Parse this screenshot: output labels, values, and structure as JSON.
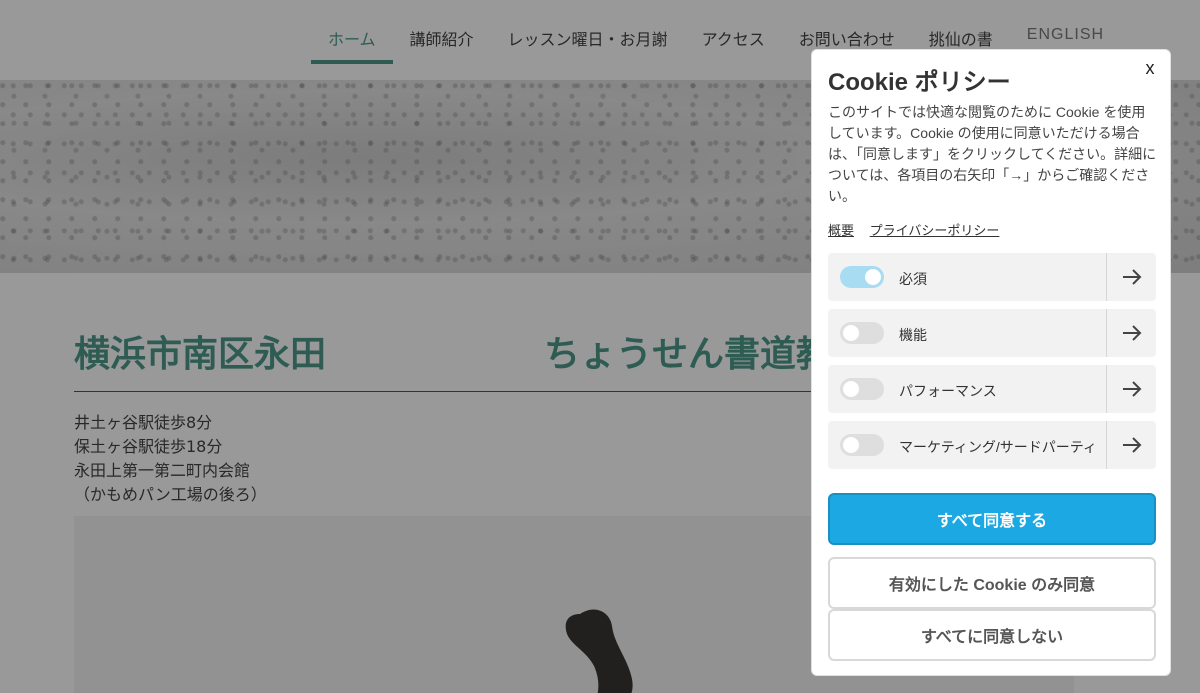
{
  "nav": {
    "items": [
      {
        "label": "ホーム",
        "active": true
      },
      {
        "label": "講師紹介",
        "active": false
      },
      {
        "label": "レッスン曜日・お月謝",
        "active": false
      },
      {
        "label": "アクセス",
        "active": false
      },
      {
        "label": "お問い合わせ",
        "active": false
      },
      {
        "label": "挑仙の書",
        "active": false
      },
      {
        "label": "ENGLISH",
        "active": false
      }
    ]
  },
  "main": {
    "title_left": "横浜市南区永田",
    "title_right": "ちょうせん書道教",
    "address_lines": [
      "井土ヶ谷駅徒歩8分",
      "保土ヶ谷駅徒歩18分",
      "永田上第一第二町内会館",
      "（かもめパン工場の後ろ）"
    ]
  },
  "cookie": {
    "close_label": "x",
    "title": "Cookie ポリシー",
    "description": "このサイトでは快適な閲覧のために Cookie を使用しています。Cookie の使用に同意いただける場合は、「同意します」をクリックしてください。詳細については、各項目の右矢印「→」からご確認ください。",
    "links": [
      "概要",
      "プライバシーポリシー"
    ],
    "categories": [
      {
        "label": "必須",
        "enabled": true
      },
      {
        "label": "機能",
        "enabled": false
      },
      {
        "label": "パフォーマンス",
        "enabled": false
      },
      {
        "label": "マーケティング/サードパーティ",
        "enabled": false
      }
    ],
    "accept_all": "すべて同意する",
    "accept_selected": "有効にした Cookie のみ同意",
    "decline_all": "すべてに同意しない"
  },
  "colors": {
    "accent_green": "#4e9a8a",
    "primary_button": "#1ca8e3",
    "toggle_on": "#a7dcf2",
    "overlay": "rgba(0,0,0,0.4)"
  }
}
